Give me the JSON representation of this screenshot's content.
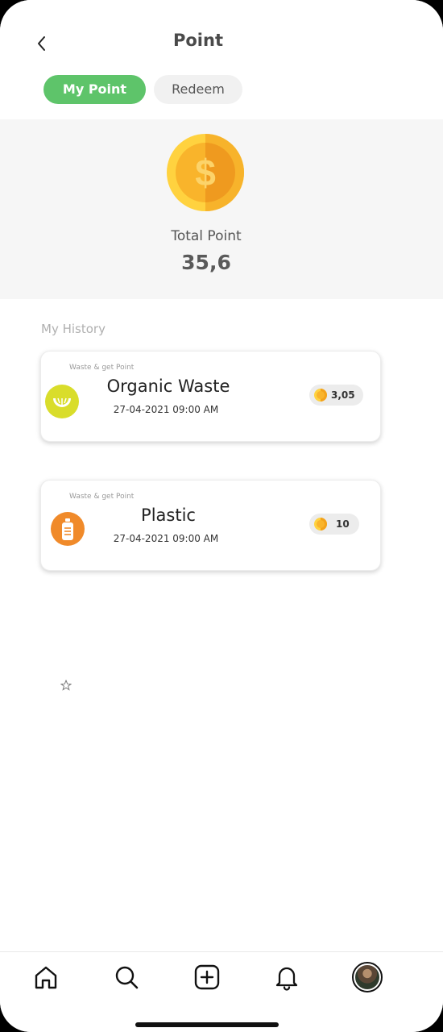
{
  "header": {
    "title": "Point",
    "tabs": [
      {
        "label": "My Point",
        "active": true
      },
      {
        "label": "Redeem",
        "active": false
      }
    ]
  },
  "summary": {
    "label": "Total Point",
    "value": "35,6"
  },
  "history": {
    "title": "My History",
    "items": [
      {
        "caption": "Waste & get Point",
        "title": "Organic  Waste",
        "date": "27-04-2021  09:00 AM",
        "points": "3,05",
        "icon": "organic-waste-icon",
        "icon_color": "#d9dd2b"
      },
      {
        "caption": "Waste & get Point",
        "title": "Plastic",
        "date": "27-04-2021  09:00 AM",
        "points": "10",
        "icon": "plastic-bottle-icon",
        "icon_color": "#f08a2a"
      }
    ]
  },
  "nav": {
    "items": [
      "home-icon",
      "search-icon",
      "add-icon",
      "bell-icon",
      "profile-avatar"
    ]
  },
  "colors": {
    "accent": "#5ec46a",
    "coin_light": "#ffd23f",
    "coin_dark": "#f3a21b"
  }
}
